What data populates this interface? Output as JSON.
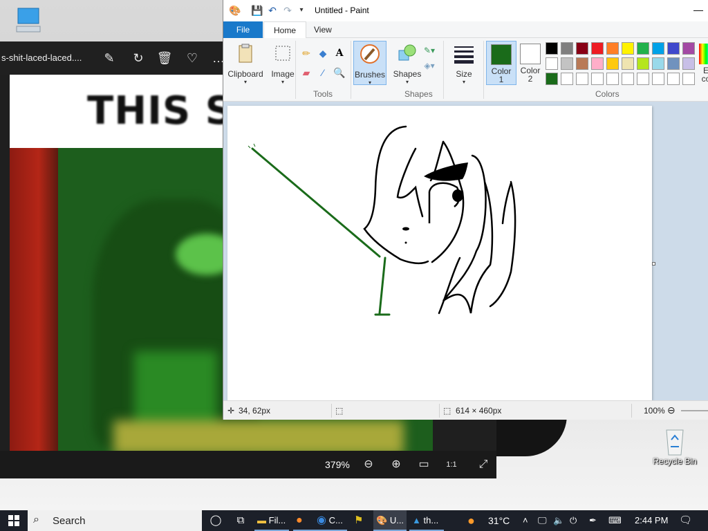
{
  "desktop": {
    "recycle_bin_label": "Recycle Bin"
  },
  "photos": {
    "filename": "s-shit-laced-laced....",
    "image_banner_text": "THIS SHI",
    "zoom": "379%",
    "buttons": {
      "edit": "edit-create-icon",
      "rotate": "rotate-icon",
      "delete": "delete-icon",
      "favorite": "heart-icon",
      "zoom_out": "zoom-out-icon",
      "zoom_in": "zoom-in-icon",
      "fit": "fit-icon",
      "actual_size": "1:1",
      "fullscreen": "fullscreen-icon"
    }
  },
  "paint": {
    "title": "Untitled - Paint",
    "tabs": [
      "File",
      "Home",
      "View"
    ],
    "ribbon": {
      "clipboard": "Clipboard",
      "image": "Image",
      "tools_group": "Tools",
      "brushes": "Brushes",
      "shapes": "Shapes",
      "shapes_group": "Shapes",
      "size": "Size",
      "color1_a": "Color",
      "color1_b": "1",
      "color2_a": "Color",
      "color2_b": "2",
      "colors_group": "Colors",
      "edit_colors_a": "E",
      "edit_colors_b": "co"
    },
    "palette_row1": [
      "#000000",
      "#7f7f7f",
      "#880015",
      "#ed1c24",
      "#ff7f27",
      "#fff200",
      "#22b14c",
      "#00a2e8",
      "#3f48cc",
      "#a349a4"
    ],
    "palette_row2": [
      "#ffffff",
      "#c3c3c3",
      "#b97a57",
      "#ffaec9",
      "#ffc90e",
      "#efe4b0",
      "#b5e61d",
      "#99d9ea",
      "#7092be",
      "#c8bfe7"
    ],
    "palette_row3": [
      "#1a6b1a",
      "#ffffff",
      "#ffffff",
      "#ffffff",
      "#ffffff",
      "#ffffff",
      "#ffffff",
      "#ffffff",
      "#ffffff",
      "#ffffff"
    ],
    "color1": "#1a6b1a",
    "color2": "#ffffff",
    "status": {
      "cursor_pos": "34, 62px",
      "canvas_size": "614 × 460px",
      "zoom": "100%"
    }
  },
  "taskbar": {
    "search_placeholder": "Search",
    "apps": [
      {
        "label": "Fil...",
        "icon": "file-explorer-icon"
      },
      {
        "label": "",
        "icon": "firefox-icon"
      },
      {
        "label": "C...",
        "icon": "chrome-icon"
      },
      {
        "label": "",
        "icon": "windows-xp-icon"
      },
      {
        "label": "U...",
        "icon": "paint-icon"
      },
      {
        "label": "th...",
        "icon": "photos-icon"
      }
    ],
    "weather": "31°C",
    "time": "2:44 PM"
  }
}
